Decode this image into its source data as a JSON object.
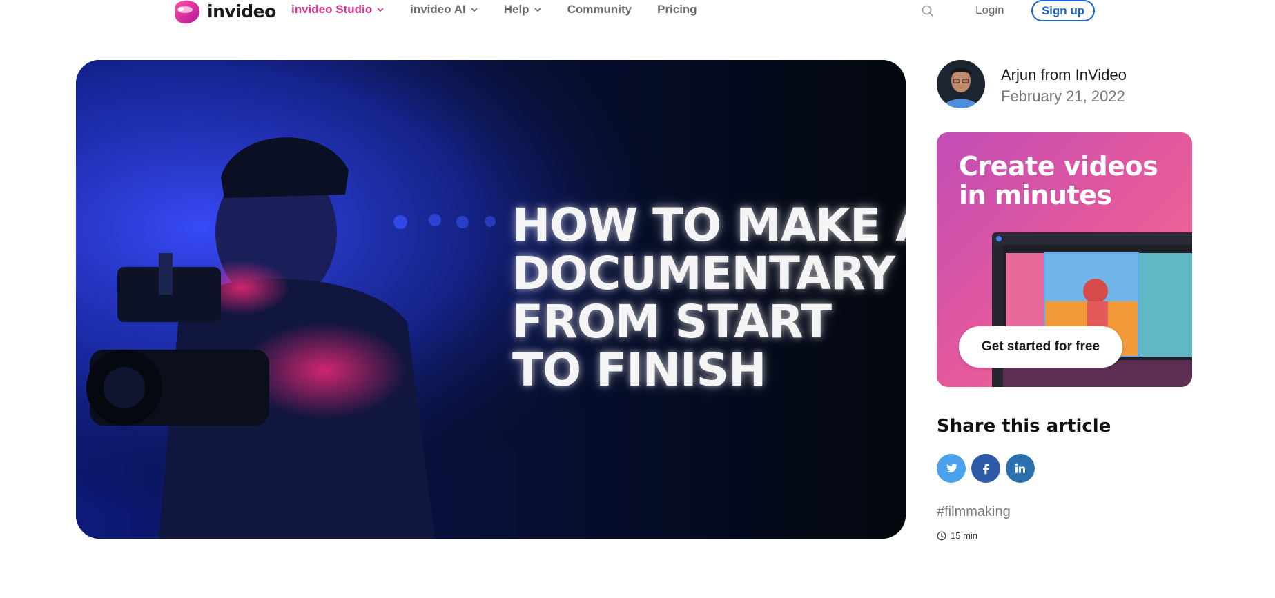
{
  "header": {
    "logo_text": "invideo",
    "nav": [
      {
        "label": "invideo Studio",
        "dropdown": true,
        "active": true
      },
      {
        "label": "invideo AI",
        "dropdown": true,
        "active": false
      },
      {
        "label": "Help",
        "dropdown": true,
        "active": false
      },
      {
        "label": "Community",
        "dropdown": false,
        "active": false
      },
      {
        "label": "Pricing",
        "dropdown": false,
        "active": false
      }
    ],
    "login_label": "Login",
    "signup_label": "Sign up"
  },
  "hero": {
    "title_lines": [
      "HOW TO MAKE A",
      "DOCUMENTARY",
      "FROM START",
      "TO FINISH"
    ]
  },
  "author": {
    "name": "Arjun from InVideo",
    "date": "February 21, 2022"
  },
  "promo": {
    "title": "Create videos in minutes",
    "cta_label": "Get started for free"
  },
  "share": {
    "title": "Share this article",
    "networks": [
      "twitter",
      "facebook",
      "linkedin"
    ]
  },
  "tag": "#filmmaking",
  "read_time": "15 min",
  "colors": {
    "brand_pink": "#d6338c",
    "signup_blue": "#1f62c9",
    "twitter": "#4aa1ec",
    "facebook": "#2e5aa8",
    "linkedin": "#2c6fad"
  }
}
